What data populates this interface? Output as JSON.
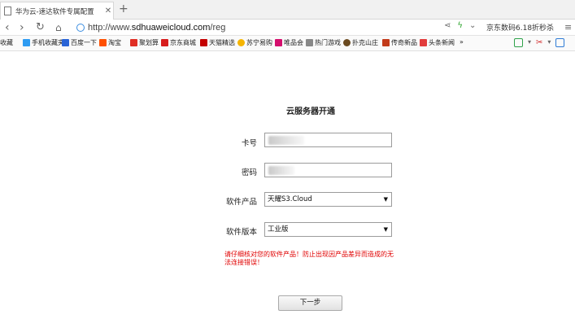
{
  "browser": {
    "tab_title": "华为云-速达软件专属配置",
    "url_prefix": "http://www.",
    "url_domain": "sdhuaweicloud.com",
    "url_path": "/reg",
    "promo_text": "京东数码6.18折秒杀"
  },
  "bookmarks": [
    {
      "label": "收藏",
      "color": "#f2b400"
    },
    {
      "label": "手机收藏夹",
      "color": "#2e9cf2"
    },
    {
      "label": "百度一下",
      "color": "#2a64d6"
    },
    {
      "label": "淘宝",
      "color": "#ff5000"
    },
    {
      "label": "聚划算",
      "color": "#e02e24"
    },
    {
      "label": "京东商城",
      "color": "#d71c1c"
    },
    {
      "label": "天猫精选",
      "color": "#c40000"
    },
    {
      "label": "苏宁易购",
      "color": "#f5b400"
    },
    {
      "label": "唯品会",
      "color": "#d40f6d"
    },
    {
      "label": "热门游戏",
      "color": "#888888"
    },
    {
      "label": "扑克山庄",
      "color": "#6b4a20"
    },
    {
      "label": "传奇新品",
      "color": "#c23b1a"
    },
    {
      "label": "头条新闻",
      "color": "#e23c3c"
    }
  ],
  "bookmarks_more": "»",
  "form": {
    "title": "云服务器开通",
    "card_label": "卡号",
    "password_label": "密码",
    "product_label": "软件产品",
    "product_value": "天耀S3.Cloud",
    "version_label": "软件版本",
    "version_value": "工业版",
    "warning": "请仔细核对您的软件产品！防止出现因产品差异而造成的无法连接错误！",
    "next_button": "下一步"
  }
}
